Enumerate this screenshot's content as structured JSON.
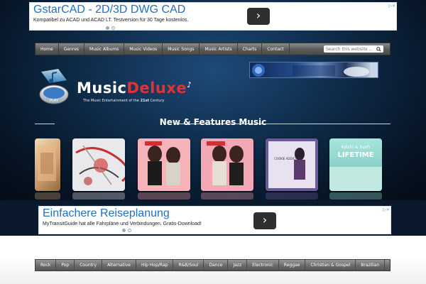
{
  "ad_top": {
    "title": "GstarCAD - 2D/3D DWG CAD",
    "description": "Kompatibel zu ACAD und ACAD LT. Testversion für 30 Tage kostenlos.",
    "arrow_icon": "chevron-right-icon",
    "corner_label": "▷×"
  },
  "nav": {
    "items": [
      "Home",
      "Genres",
      "Music Albums",
      "Music Videos",
      "Music Songs",
      "Music Artists",
      "Charts",
      "Contact"
    ],
    "search_placeholder": "Search this website ...",
    "search_icon": "search-icon"
  },
  "logo": {
    "music": "Music",
    "deluxe": "Deluxe",
    "tagline_prefix": "The Music   Entertainment of the ",
    "tagline_bold": "21st",
    "tagline_suffix": " Century",
    "play_label": "PLAY"
  },
  "section": {
    "title": "New & Features Music"
  },
  "albums": {
    "colors": [
      "#e8c49a",
      "#d9d9dc",
      "#f29a9a",
      "#f0a0ad",
      "#6c5a94",
      "#8fd6cf"
    ],
    "album_5_text": "COOKIE ADDICTION",
    "album_6_line1": "koishi & hush",
    "album_6_line2": "LIFETIME"
  },
  "ad_mid": {
    "title": "Einfachere Reiseplanung",
    "description": "MyTransitGuide hat alle Fahrpläne und Verbindungen. Gratis-Download!",
    "arrow_icon": "chevron-right-icon",
    "corner_label": "▷×"
  },
  "genres": {
    "items": [
      "Rock",
      "Pop",
      "Country",
      "Alternative",
      "Hip Hop/Rap",
      "R&B/Soul",
      "Dance",
      "Jazz",
      "Electronic",
      "Reggae",
      "Christian & Gospel",
      "Brazilian"
    ]
  }
}
